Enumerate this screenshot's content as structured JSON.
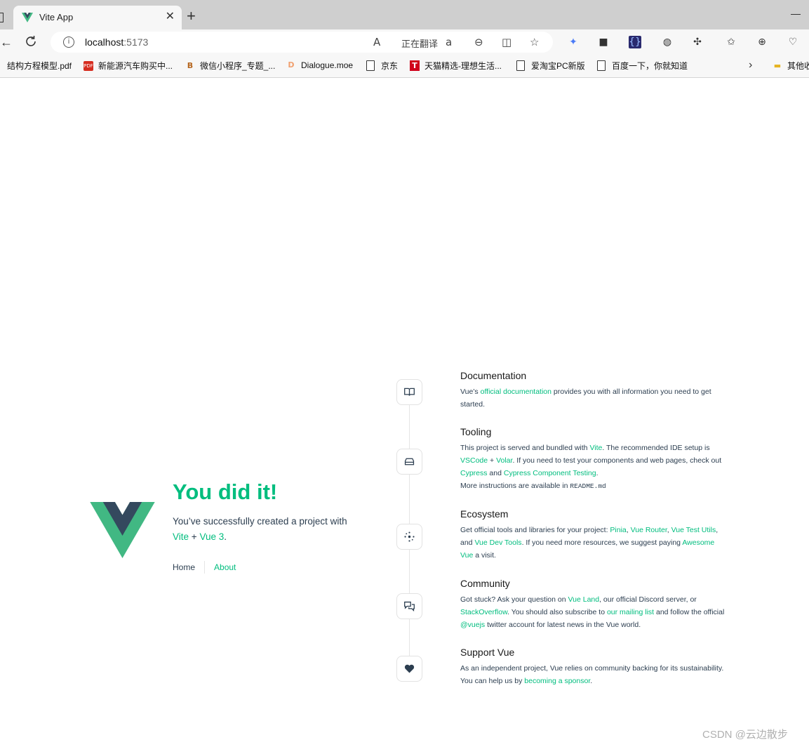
{
  "browser": {
    "tab_title": "Vite App",
    "url_host": "localhost",
    "url_port": ":5173",
    "translate_label": "正在翻译"
  },
  "bookmarks": [
    "结构方程模型.pdf",
    "新能源汽车购买中...",
    "微信小程序_专题_...",
    "Dialogue.moe",
    "京东",
    "天猫精选-理想生活...",
    "爱淘宝PC新版",
    "百度一下，你就知道",
    "其他收"
  ],
  "hero": {
    "title": "You did it!",
    "subtitle_prefix": "You’ve successfully created a project with",
    "link_vite": "Vite",
    "plus": "+",
    "link_vue": "Vue 3",
    "period": "."
  },
  "nav": {
    "home": "Home",
    "about": "About"
  },
  "sections": {
    "documentation": {
      "title": "Documentation",
      "t1": "Vue’s ",
      "l1": "official documentation",
      "t2": " provides you with all information you need to get started."
    },
    "tooling": {
      "title": "Tooling",
      "t1": "This project is served and bundled with ",
      "l1": "Vite",
      "t2": ". The recommended IDE setup is ",
      "l2": "VSCode",
      "t3": " + ",
      "l3": "Volar",
      "t4": ". If you need to test your components and web pages, check out ",
      "l4": "Cypress",
      "t5": " and ",
      "l5": "Cypress Component Testing",
      "t6": ".",
      "t7": "More instructions are available in ",
      "code": "README.md"
    },
    "ecosystem": {
      "title": "Ecosystem",
      "t1": "Get official tools and libraries for your project: ",
      "l1": "Pinia",
      "t2": ", ",
      "l2": "Vue Router",
      "t3": ", ",
      "l3": "Vue Test Utils",
      "t4": ", and ",
      "l4": "Vue Dev Tools",
      "t5": ". If you need more resources, we suggest paying ",
      "l5": "Awesome Vue",
      "t6": " a visit."
    },
    "community": {
      "title": "Community",
      "t1": "Got stuck? Ask your question on ",
      "l1": "Vue Land",
      "t2": ", our official Discord server, or ",
      "l2": "StackOverflow",
      "t3": ". You should also subscribe to ",
      "l3": "our mailing list",
      "t4": " and follow the official ",
      "l4": "@vuejs",
      "t5": " twitter account for latest news in the Vue world."
    },
    "support": {
      "title": "Support Vue",
      "t1": "As an independent project, Vue relies on community backing for its sustainability. You can help us by ",
      "l1": "becoming a sponsor",
      "t2": "."
    }
  },
  "watermark": "CSDN @云边散步",
  "colors": {
    "vue_green": "#41b883",
    "vue_dark": "#34495e",
    "link_green": "hsla(160,100%,37%,1)",
    "text": "#2c3e50"
  }
}
